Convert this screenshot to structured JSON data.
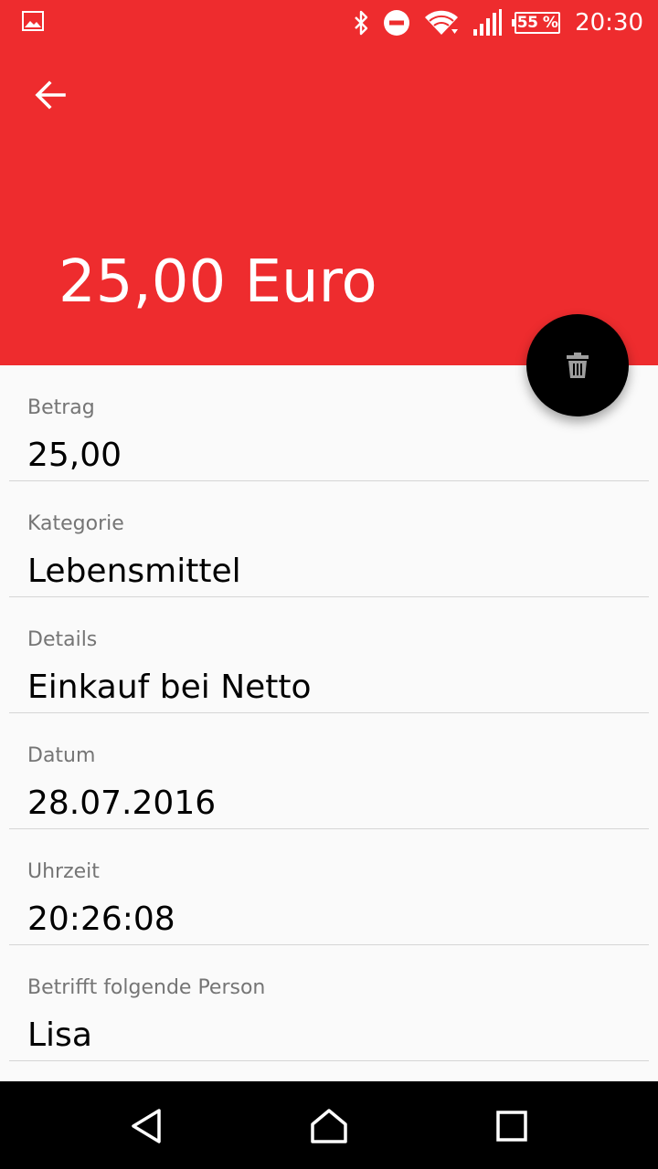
{
  "status_bar": {
    "battery_text": "55 %",
    "time": "20:30",
    "icons": [
      "gallery-icon",
      "bluetooth-icon",
      "do-not-disturb-icon",
      "wifi-icon",
      "signal-icon",
      "battery-icon"
    ]
  },
  "app_bar": {
    "color": "#ee2c2e",
    "back_icon": "arrow-back-icon",
    "title": "25,00 Euro"
  },
  "fab": {
    "icon": "trash-icon",
    "color": "#000000"
  },
  "fields": [
    {
      "label": "Betrag",
      "value": "25,00"
    },
    {
      "label": "Kategorie",
      "value": "Lebensmittel"
    },
    {
      "label": "Details",
      "value": "Einkauf bei Netto"
    },
    {
      "label": "Datum",
      "value": "28.07.2016"
    },
    {
      "label": "Uhrzeit",
      "value": "20:26:08"
    },
    {
      "label": "Betrifft folgende Person",
      "value": "Lisa"
    }
  ],
  "nav_bar": {
    "icons": [
      "back-triangle-icon",
      "home-icon",
      "recents-icon"
    ]
  }
}
